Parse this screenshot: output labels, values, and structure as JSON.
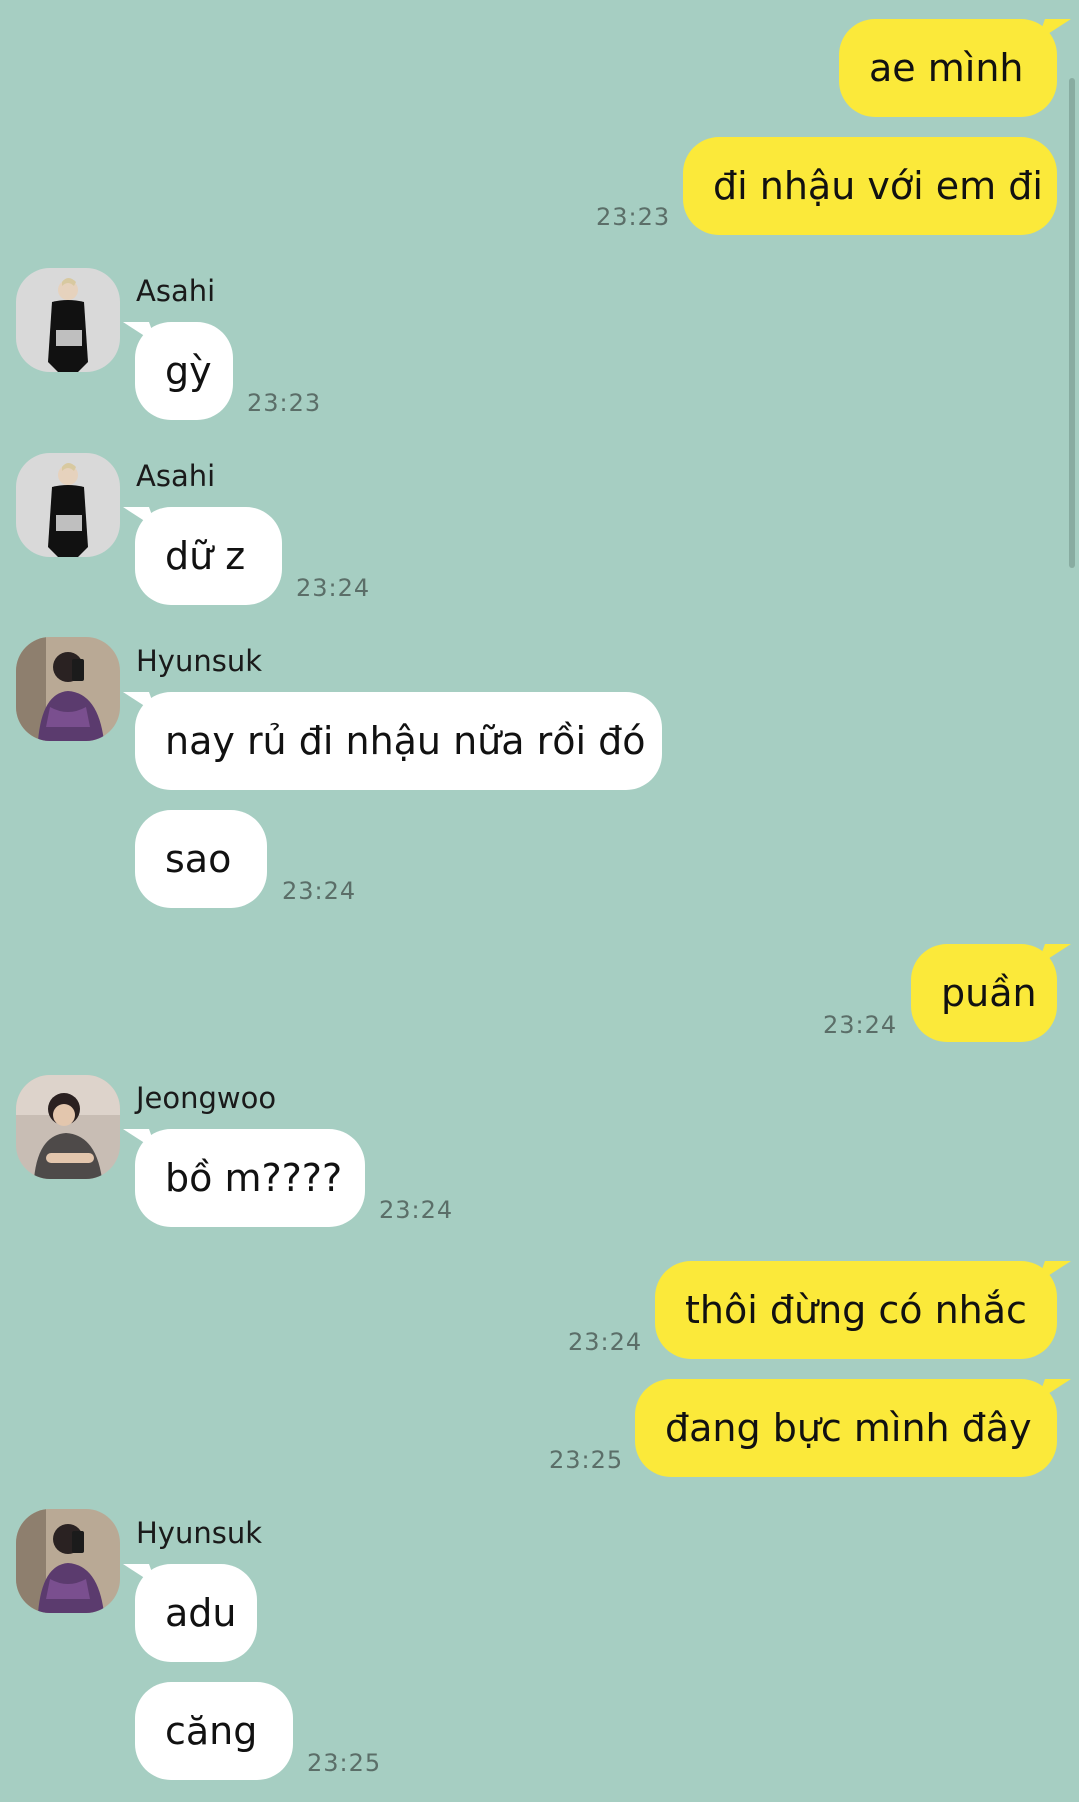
{
  "messages": {
    "m1": {
      "text": "ae mình"
    },
    "m2": {
      "text": "đi nhậu với em đi",
      "time": "23:23"
    },
    "m3": {
      "sender": "Asahi",
      "text": "gỳ",
      "time": "23:23"
    },
    "m4": {
      "sender": "Asahi",
      "text": "dữ z",
      "time": "23:24"
    },
    "m5": {
      "sender": "Hyunsuk",
      "text": "nay rủ đi nhậu nữa rồi đó"
    },
    "m6": {
      "text": "sao",
      "time": "23:24"
    },
    "m7": {
      "text": "puần",
      "time": "23:24"
    },
    "m8": {
      "sender": "Jeongwoo",
      "text": "bồ m????",
      "time": "23:24"
    },
    "m9": {
      "text": "thôi đừng có nhắc",
      "time": "23:24"
    },
    "m10": {
      "text": "đang bực mình đây",
      "time": "23:25"
    },
    "m11": {
      "sender": "Hyunsuk",
      "text": "adu"
    },
    "m12": {
      "text": "căng",
      "time": "23:25"
    }
  },
  "colors": {
    "background": "#a6cec2",
    "outgoing_bubble": "#fbe93a",
    "incoming_bubble": "#ffffff",
    "timestamp": "#5b6e68"
  }
}
